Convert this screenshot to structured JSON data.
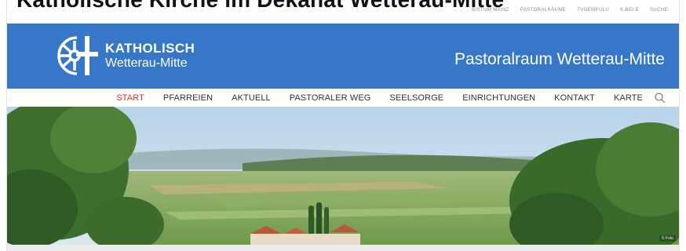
{
  "page": {
    "cropped_heading": "Katholische Kirche im Dekanat Wetterau-Mitte",
    "utility_links": [
      "BISTUM MAINZ",
      "PASTORALRÄUME",
      "TVGEMPULU",
      "K.BEI.E",
      "SUCHE"
    ],
    "logo_line1": "KATHOLISCH",
    "logo_line2": "Wetterau-Mitte",
    "site_name": "Pastoralraum Wetterau-Mitte",
    "nav": [
      {
        "label": "START",
        "active": true
      },
      {
        "label": "PFARREIEN",
        "active": false
      },
      {
        "label": "AKTUELL",
        "active": false
      },
      {
        "label": "PASTORALER WEG",
        "active": false
      },
      {
        "label": "SEELSORGE",
        "active": false
      },
      {
        "label": "EINRICHTUNGEN",
        "active": false
      },
      {
        "label": "KONTAKT",
        "active": false
      },
      {
        "label": "KARTE",
        "active": false
      }
    ],
    "search_icon": "search-icon",
    "hero_credit": "© Foto"
  },
  "colors": {
    "header_blue": "#3677c8",
    "nav_active": "#d9332c",
    "nav_text": "#333333"
  }
}
